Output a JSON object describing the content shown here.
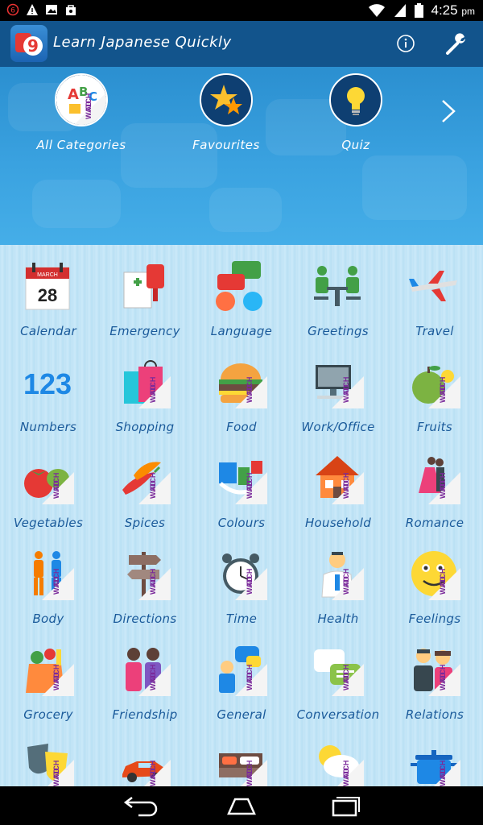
{
  "status_bar": {
    "time": "4:25",
    "time_suffix": "pm"
  },
  "action_bar": {
    "title": "Learn Japanese Quickly",
    "info_icon": "info-icon",
    "settings_icon": "wrench-icon"
  },
  "hero": {
    "items": [
      {
        "label": "All Categories",
        "icon": "abc-blocks-icon",
        "ad": true
      },
      {
        "label": "Favourites",
        "icon": "stars-icon",
        "ad": false
      },
      {
        "label": "Quiz",
        "icon": "lightbulb-icon",
        "ad": false
      }
    ],
    "next_icon": "chevron-right-icon"
  },
  "ad_badge": {
    "line1": "WATCH",
    "line2": "AD"
  },
  "calendar_icon": {
    "month": "MARCH",
    "day": "28"
  },
  "numbers_icon": {
    "text": "123"
  },
  "categories": [
    {
      "label": "Calendar",
      "icon": "calendar-icon",
      "ad": false
    },
    {
      "label": "Emergency",
      "icon": "medical-kit-icon",
      "ad": false
    },
    {
      "label": "Language",
      "icon": "speech-bubbles-icon",
      "ad": false
    },
    {
      "label": "Greetings",
      "icon": "meeting-icon",
      "ad": false
    },
    {
      "label": "Travel",
      "icon": "airplane-icon",
      "ad": false
    },
    {
      "label": "Numbers",
      "icon": "numbers-icon",
      "ad": false
    },
    {
      "label": "Shopping",
      "icon": "shopping-bag-icon",
      "ad": true
    },
    {
      "label": "Food",
      "icon": "burger-icon",
      "ad": true
    },
    {
      "label": "Work/Office",
      "icon": "computer-icon",
      "ad": true
    },
    {
      "label": "Fruits",
      "icon": "apple-icon",
      "ad": true
    },
    {
      "label": "Vegetables",
      "icon": "tomato-icon",
      "ad": true
    },
    {
      "label": "Spices",
      "icon": "chili-icon",
      "ad": true
    },
    {
      "label": "Colours",
      "icon": "paint-icon",
      "ad": true
    },
    {
      "label": "Household",
      "icon": "house-icon",
      "ad": true
    },
    {
      "label": "Romance",
      "icon": "dancing-couple-icon",
      "ad": true
    },
    {
      "label": "Body",
      "icon": "human-body-icon",
      "ad": true
    },
    {
      "label": "Directions",
      "icon": "signpost-icon",
      "ad": true
    },
    {
      "label": "Time",
      "icon": "alarm-clock-icon",
      "ad": true
    },
    {
      "label": "Health",
      "icon": "doctor-icon",
      "ad": true
    },
    {
      "label": "Feelings",
      "icon": "smiley-icon",
      "ad": true
    },
    {
      "label": "Grocery",
      "icon": "grocery-bag-icon",
      "ad": true
    },
    {
      "label": "Friendship",
      "icon": "friends-icon",
      "ad": true
    },
    {
      "label": "General",
      "icon": "person-thinking-icon",
      "ad": true
    },
    {
      "label": "Conversation",
      "icon": "chat-bubbles-icon",
      "ad": true
    },
    {
      "label": "Relations",
      "icon": "couple-icon",
      "ad": true
    },
    {
      "label": "",
      "icon": "theatre-masks-icon",
      "ad": true
    },
    {
      "label": "",
      "icon": "car-icon",
      "ad": true
    },
    {
      "label": "",
      "icon": "bed-icon",
      "ad": true
    },
    {
      "label": "",
      "icon": "weather-icon",
      "ad": true
    },
    {
      "label": "",
      "icon": "cooking-pot-icon",
      "ad": true
    }
  ],
  "nav_bar": {
    "back_icon": "back-icon",
    "home_icon": "home-icon",
    "recents_icon": "recents-icon"
  },
  "colors": {
    "action_bar": "#12548c",
    "hero_top": "#2b8fd0",
    "label": "#1a5a9a",
    "ad_text": "#7a2a9a"
  }
}
